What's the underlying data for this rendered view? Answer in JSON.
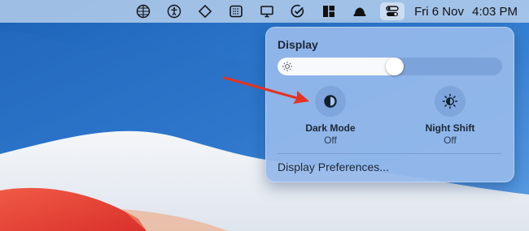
{
  "colors": {
    "menubar": "#c3d7f0",
    "panel": "#96b9eb",
    "accent_arrow": "#e53221",
    "wallpaper_blue": "#2f7bd0",
    "wallpaper_white": "#f2f4f7",
    "wallpaper_red": "#e9443a"
  },
  "menubar": {
    "icons": [
      "globe-grid-icon",
      "accessibility-icon",
      "diamond-icon",
      "grid-box-icon",
      "display-icon",
      "checkmark-circle-icon",
      "tiles-icon",
      "hat-icon",
      "control-center-icon"
    ],
    "clock": {
      "date": "Fri 6 Nov",
      "time": "4:03 PM"
    }
  },
  "panel": {
    "title": "Display",
    "brightness": 0.52,
    "toggles": [
      {
        "label": "Dark Mode",
        "state": "Off",
        "icon": "dark-mode-icon"
      },
      {
        "label": "Night Shift",
        "state": "Off",
        "icon": "night-shift-icon"
      }
    ],
    "preferences_link": "Display Preferences..."
  }
}
